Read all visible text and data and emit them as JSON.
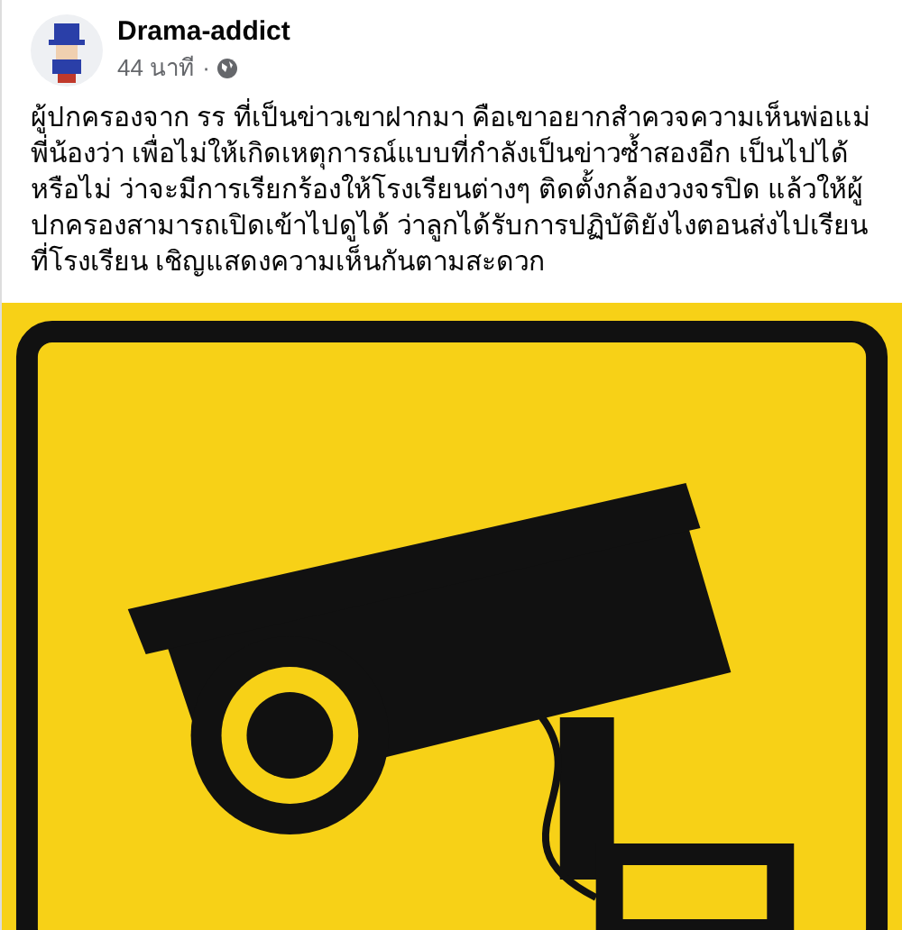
{
  "post": {
    "author": "Drama-addict",
    "time": "44 นาที",
    "separator": "·",
    "text": "ผู้ปกครองจาก รร ที่เป็นข่าวเขาฝากมา คือเขาอยากสำควจความเห็นพ่อแม่พี่น้องว่า เพื่อไม่ให้เกิดเหตุการณ์แบบที่กำลังเป็นข่าวซ้ำสองอีก เป็นไปได้หรือไม่ ว่าจะมีการเรียกร้องให้โรงเรียนต่างๆ ติดตั้งกล้องวงจรปิด แล้วให้ผู้ปกครองสามารถเปิดเข้าไปดูได้ ว่าลูกได้รับการปฏิบัติยังไงตอนส่งไปเรียนที่โรงเรียน เชิญแสดงความเห็นกันตามสะดวก"
  }
}
